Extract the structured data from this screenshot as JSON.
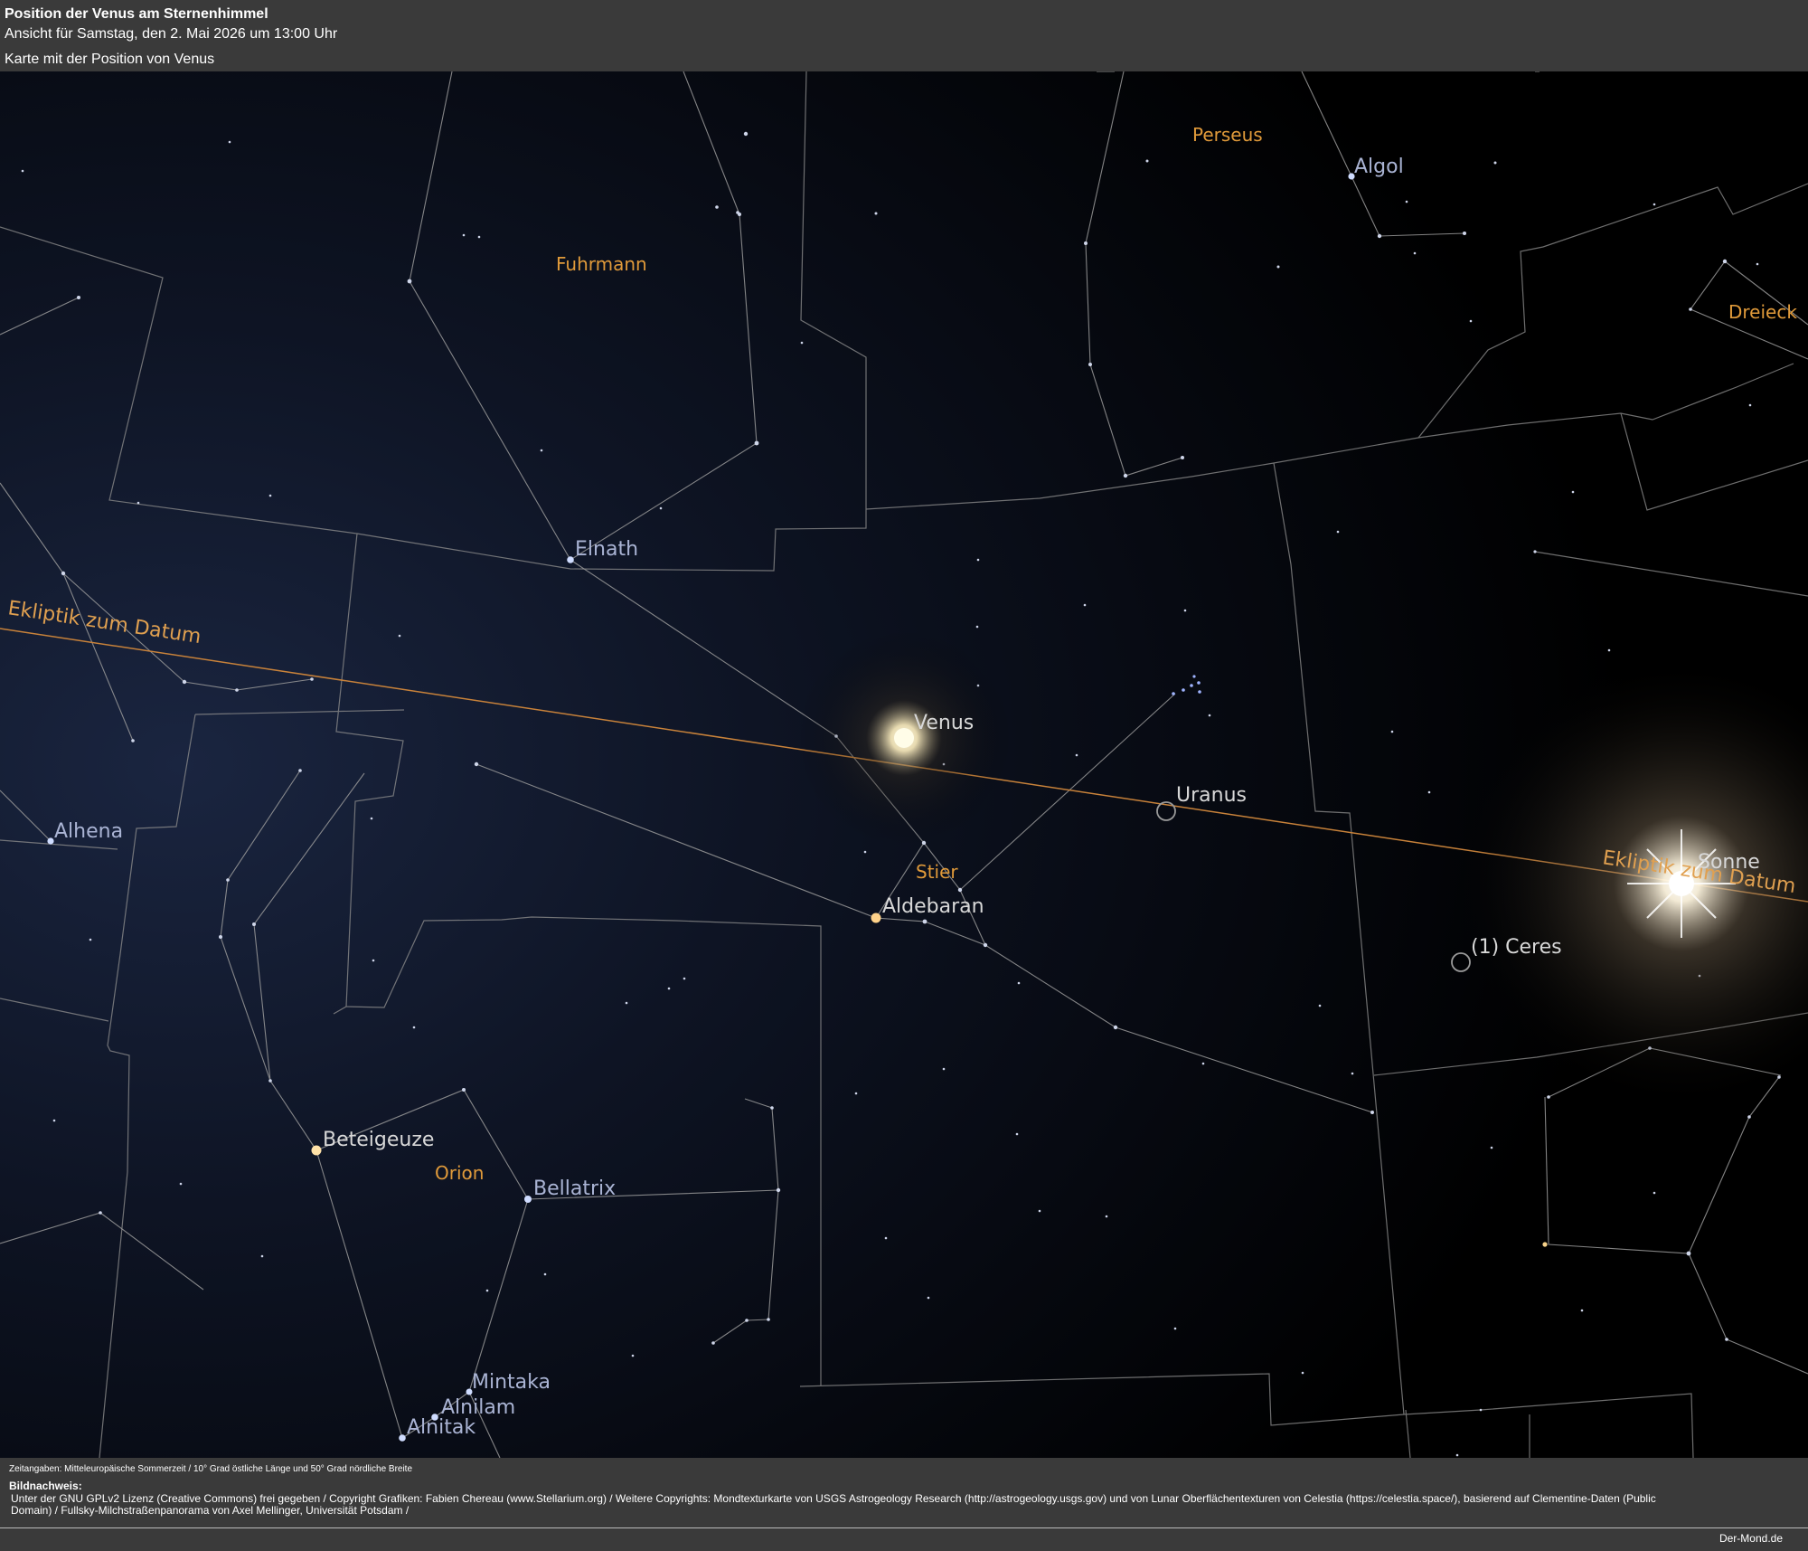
{
  "header": {
    "title": "Position der Venus am Sternenhimmel",
    "subtitle": "Ansicht für Samstag, den 2. Mai 2026 um 13:00 Uhr",
    "map_label": "Karte mit der Position von Venus"
  },
  "map": {
    "constellations": {
      "fuhrmann": "Fuhrmann",
      "perseus": "Perseus",
      "dreieck": "Dreieck",
      "stier": "Stier",
      "orion": "Orion"
    },
    "stars": {
      "algol": "Algol",
      "elnath": "Elnath",
      "alhena": "Alhena",
      "aldebaran": "Aldebaran",
      "beteigeuze": "Beteigeuze",
      "bellatrix": "Bellatrix",
      "mintaka": "Mintaka",
      "alnilam": "Alnilam",
      "alnitak": "Alnitak"
    },
    "bodies": {
      "venus": "Venus",
      "uranus": "Uranus",
      "sonne": "Sonne",
      "ceres": "(1) Ceres"
    },
    "ecliptic_label": "Ekliptik zum Datum",
    "colors": {
      "ecliptic": "#c8823a",
      "constellation_label": "#e09a3a",
      "star_label": "#aab4d4",
      "lines": "#9a9a9a"
    }
  },
  "footer": {
    "zeitangaben": "Zeitangaben: Mitteleuropäische Sommerzeit / 10° Grad östliche Länge und 50° Grad nördliche Breite",
    "bildnachweis_title": "Bildnachweis:",
    "bildnachweis_text": "Unter der GNU GPLv2 Lizenz (Creative Commons) frei gegeben / Copyright Grafiken: Fabien Chereau (www.Stellarium.org) / Weitere Copyrights: Mondtexturkarte von USGS Astrogeology Research (http://astrogeology.usgs.gov) und von Lunar Oberflächentexturen von Celestia (https://celestia.space/), basierend auf Clementine-Daten (Public Domain) / Fullsky-Milchstraßenpanorama von Axel Mellinger, Universität Potsdam /",
    "site": "Der-Mond.de"
  }
}
